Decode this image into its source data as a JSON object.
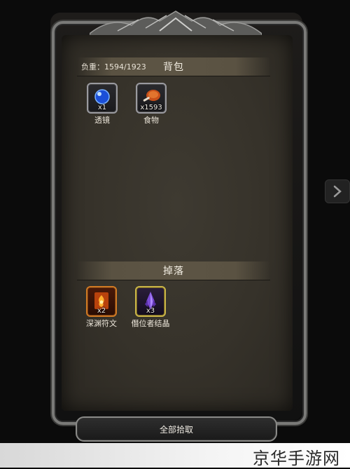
{
  "backpack": {
    "title": "背包",
    "load_text": "负重：1594/1923",
    "items": [
      {
        "name": "透镜",
        "qty": "x1",
        "icon": "blue-orb-icon"
      },
      {
        "name": "食物",
        "qty": "x1593",
        "icon": "roast-meat-icon"
      }
    ]
  },
  "drops": {
    "title": "掉落",
    "items": [
      {
        "name": "深渊符文",
        "qty": "x2",
        "icon": "fire-rune-icon"
      },
      {
        "name": "僭位者结晶",
        "qty": "x3",
        "icon": "purple-crystal-icon"
      }
    ]
  },
  "pickup_all_label": "全部拾取",
  "watermark": "京华手游网",
  "colors": {
    "panel": "#3b372e",
    "rarity_orange": "#d07a24",
    "rarity_gold": "#c9b448",
    "frame_metal": "#7a7a78"
  }
}
